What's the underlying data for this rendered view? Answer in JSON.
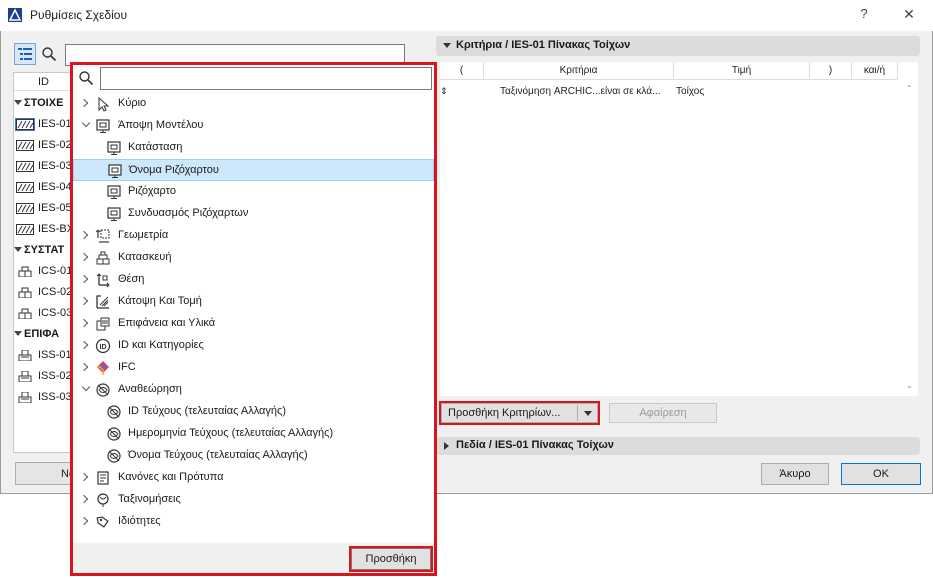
{
  "window": {
    "title": "Ρυθμίσεις Σχεδίου",
    "help_label": "?",
    "close_label": "✕"
  },
  "left_panel": {
    "column_id": "ID",
    "groups": [
      {
        "label": "ΣΤΟΙΧΕ",
        "items": [
          "IES-01",
          "IES-02",
          "IES-03",
          "IES-04",
          "IES-05",
          "IES-BX"
        ]
      },
      {
        "label": "ΣΥΣΤΑΤ",
        "items": [
          "ICS-01",
          "ICS-02",
          "ICS-03"
        ]
      },
      {
        "label": "ΕΠΙΦΑ",
        "items": [
          "ISS-01",
          "ISS-02",
          "ISS-03"
        ]
      }
    ],
    "new_button": "Να"
  },
  "criteria": {
    "section_title": "Κριτήρια / IES-01 Πίνακας Τοίχων",
    "columns": [
      "(",
      "Κριτήρια",
      "Τιμή",
      ")",
      "και/ή"
    ],
    "row": {
      "criterion": "Ταξινόμηση ARCHIC...είναι σε κλά...",
      "value": "Τοίχος"
    },
    "add_button": "Προσθήκη Κριτηρίων...",
    "remove_button": "Αφαίρεση"
  },
  "fields": {
    "section_title": "Πεδία / IES-01 Πίνακας Τοίχων"
  },
  "footer": {
    "cancel": "Άκυρο",
    "ok": "OK"
  },
  "popup": {
    "search_value": "",
    "items": [
      {
        "label": "Κύριο",
        "icon": "cursor-icon",
        "level": 0,
        "expand": "right"
      },
      {
        "label": "Άποψη Μοντέλου",
        "icon": "model-view-icon",
        "level": 0,
        "expand": "down"
      },
      {
        "label": "Κατάσταση",
        "icon": "model-view-icon",
        "level": 1,
        "expand": ""
      },
      {
        "label": "Όνομα Ριζόχαρτου",
        "icon": "model-view-icon",
        "level": 1,
        "expand": "",
        "selected": true
      },
      {
        "label": "Ριζόχαρτο",
        "icon": "model-view-icon",
        "level": 1,
        "expand": ""
      },
      {
        "label": "Συνδυασμός Ριζόχαρτων",
        "icon": "model-view-icon",
        "level": 1,
        "expand": ""
      },
      {
        "label": "Γεωμετρία",
        "icon": "geometry-icon",
        "level": 0,
        "expand": "right"
      },
      {
        "label": "Κατασκευή",
        "icon": "construction-icon",
        "level": 0,
        "expand": "right"
      },
      {
        "label": "Θέση",
        "icon": "position-icon",
        "level": 0,
        "expand": "right"
      },
      {
        "label": "Κάτοψη Και Τομή",
        "icon": "floor-plan-icon",
        "level": 0,
        "expand": "right"
      },
      {
        "label": "Επιφάνεια και Υλικά",
        "icon": "surface-icon",
        "level": 0,
        "expand": "right"
      },
      {
        "label": "ID και Κατηγορίες",
        "icon": "id-icon",
        "level": 0,
        "expand": "right"
      },
      {
        "label": "IFC",
        "icon": "ifc-icon",
        "level": 0,
        "expand": "right"
      },
      {
        "label": "Αναθεώρηση",
        "icon": "revision-icon",
        "level": 0,
        "expand": "down"
      },
      {
        "label": "ID Τεύχους (τελευταίας Αλλαγής)",
        "icon": "revision-icon",
        "level": 1,
        "expand": ""
      },
      {
        "label": "Ημερομηνία Τεύχους (τελευταίας Αλλαγής)",
        "icon": "revision-icon",
        "level": 1,
        "expand": ""
      },
      {
        "label": "Όνομα Τεύχους (τελευταίας Αλλαγής)",
        "icon": "revision-icon",
        "level": 1,
        "expand": ""
      },
      {
        "label": "Κανόνες και Πρότυπα",
        "icon": "rules-icon",
        "level": 0,
        "expand": "right"
      },
      {
        "label": "Ταξινομήσεις",
        "icon": "classification-icon",
        "level": 0,
        "expand": "right"
      },
      {
        "label": "Ιδιότητες",
        "icon": "properties-icon",
        "level": 0,
        "expand": "right"
      }
    ],
    "add_button": "Προσθήκη"
  },
  "colors": {
    "highlight_red": "#d9141c",
    "selection_blue": "#cde8fb"
  }
}
